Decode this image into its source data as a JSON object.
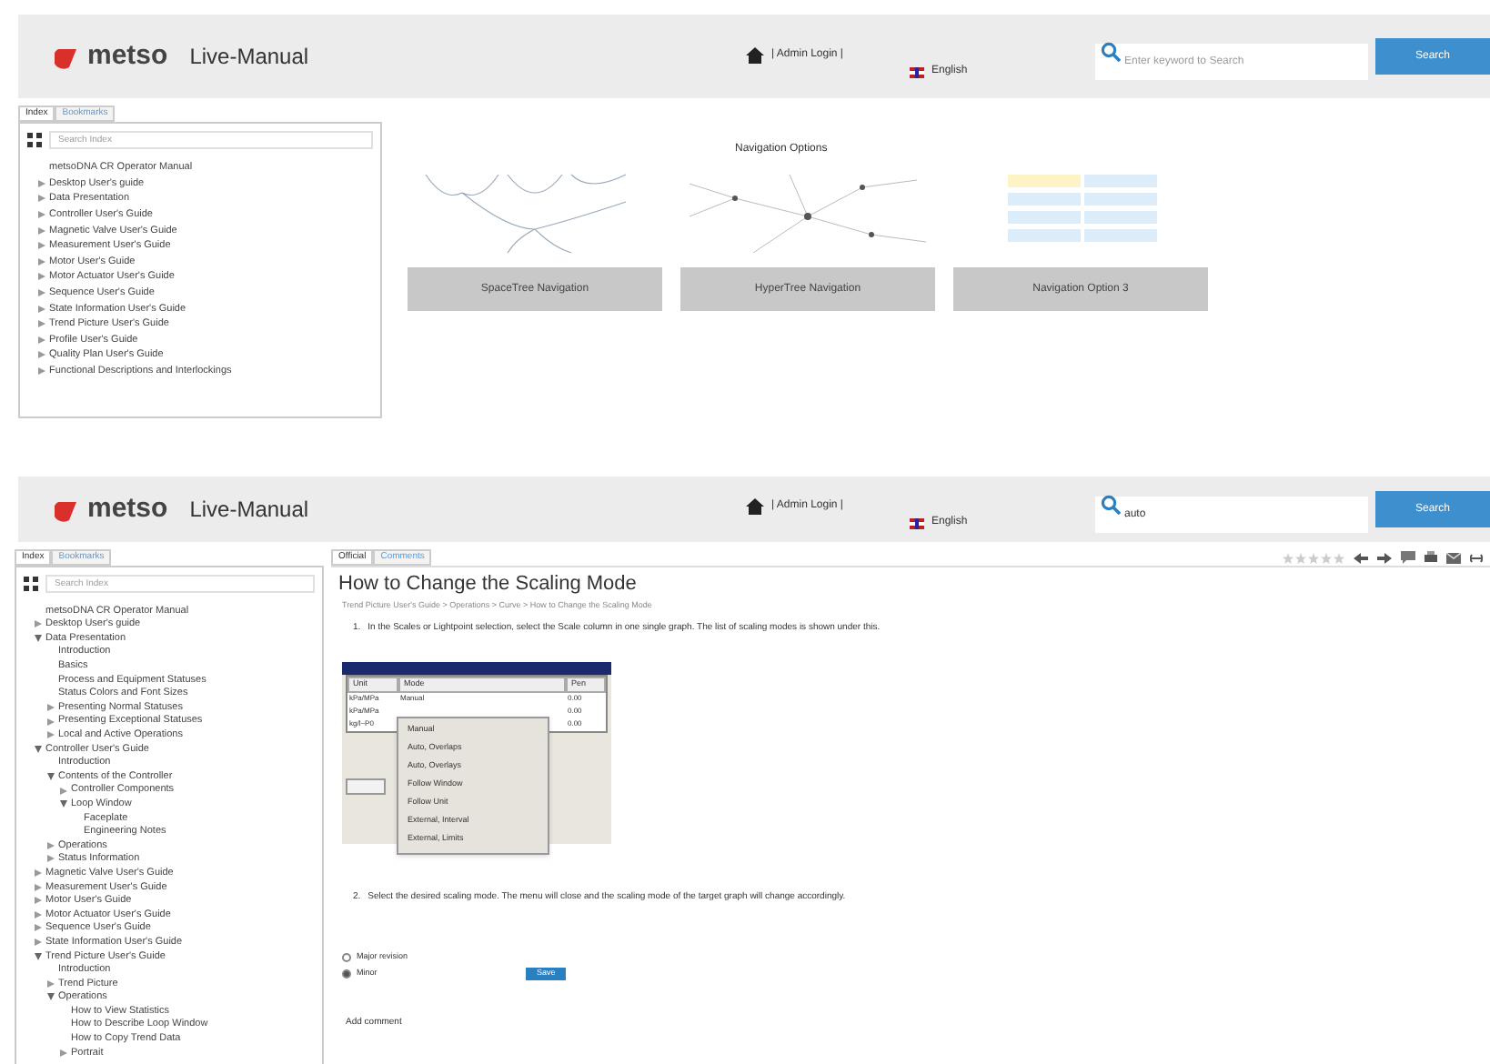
{
  "panels": [
    {
      "header": {
        "logo": "metso",
        "app_name": "Live-Manual",
        "admin_link": "| Admin Login |",
        "language": "English",
        "search": {
          "placeholder": "Enter keyword to Search"
        },
        "search_button": "Search"
      },
      "sidebar": {
        "tabs": [
          {
            "label": "Index",
            "selected": true
          },
          {
            "label": "Bookmarks",
            "selected": false
          }
        ],
        "search_placeholder": "Search Index",
        "tree": [
          {
            "label": "metsoDNA CR Operator Manual",
            "kind": "page"
          },
          {
            "label": "Desktop User's guide",
            "kind": "folder",
            "expanded": false
          },
          {
            "label": "Data Presentation",
            "kind": "folder",
            "expanded": false
          },
          {
            "label": "Controller User's Guide",
            "kind": "folder",
            "expanded": false
          },
          {
            "label": "Magnetic Valve User's Guide",
            "kind": "folder",
            "expanded": false
          },
          {
            "label": "Measurement User's Guide",
            "kind": "folder",
            "expanded": false
          },
          {
            "label": "Motor User's Guide",
            "kind": "folder",
            "expanded": false
          },
          {
            "label": "Motor Actuator User's Guide",
            "kind": "folder",
            "expanded": false
          },
          {
            "label": "Sequence User's Guide",
            "kind": "folder",
            "expanded": false
          },
          {
            "label": "State Information User's Guide",
            "kind": "folder",
            "expanded": false
          },
          {
            "label": "Trend Picture User's Guide",
            "kind": "folder",
            "expanded": false
          },
          {
            "label": "Profile User's Guide",
            "kind": "folder",
            "expanded": false
          },
          {
            "label": "Quality Plan User's Guide",
            "kind": "folder",
            "expanded": false
          },
          {
            "label": "Functional Descriptions and Interlockings",
            "kind": "folder",
            "expanded": false
          }
        ]
      },
      "content": {
        "kind": "navigation",
        "heading": "Navigation Options",
        "options": [
          {
            "label": "SpaceTree Navigation",
            "kind": "spacetree"
          },
          {
            "label": "HyperTree Navigation",
            "kind": "hypertree"
          },
          {
            "label": "Navigation Option 3",
            "kind": "grid"
          }
        ]
      }
    },
    {
      "header": {
        "logo": "metso",
        "app_name": "Live-Manual",
        "admin_link": "| Admin Login |",
        "language": "English",
        "search": {
          "value": "auto"
        },
        "search_button": "Search"
      },
      "sidebar": {
        "tabs": [
          {
            "label": "Index",
            "selected": true
          },
          {
            "label": "Bookmarks",
            "selected": false
          }
        ],
        "search_placeholder": "Search Index",
        "tree": [
          {
            "label": "metsoDNA CR Operator Manual",
            "kind": "page"
          },
          {
            "label": "Desktop User's guide",
            "kind": "folder",
            "expanded": false
          },
          {
            "label": "Data Presentation",
            "kind": "folder",
            "expanded": true,
            "children": [
              {
                "label": "Introduction",
                "kind": "page"
              },
              {
                "label": "Basics",
                "kind": "page"
              },
              {
                "label": "Process and Equipment Statuses",
                "kind": "page"
              },
              {
                "label": "Status Colors and Font Sizes",
                "kind": "page"
              },
              {
                "label": "Presenting Normal Statuses",
                "kind": "folder",
                "expanded": false
              },
              {
                "label": "Presenting Exceptional Statuses",
                "kind": "folder",
                "expanded": false
              },
              {
                "label": "Local and Active Operations",
                "kind": "folder",
                "expanded": false
              }
            ]
          },
          {
            "label": "Controller User's Guide",
            "kind": "folder",
            "expanded": true,
            "children": [
              {
                "label": "Introduction",
                "kind": "page"
              },
              {
                "label": "Contents of the Controller",
                "kind": "folder",
                "expanded": true,
                "children": [
                  {
                    "label": "Controller Components",
                    "kind": "folder",
                    "expanded": false
                  },
                  {
                    "label": "Loop Window",
                    "kind": "folder",
                    "expanded": true,
                    "children": [
                      {
                        "label": "Faceplate",
                        "kind": "page"
                      },
                      {
                        "label": "Engineering Notes",
                        "kind": "page"
                      }
                    ]
                  }
                ]
              },
              {
                "label": "Operations",
                "kind": "folder",
                "expanded": false
              },
              {
                "label": "Status Information",
                "kind": "folder",
                "expanded": false
              }
            ]
          },
          {
            "label": "Magnetic Valve User's Guide",
            "kind": "folder",
            "expanded": false
          },
          {
            "label": "Measurement User's Guide",
            "kind": "folder",
            "expanded": false
          },
          {
            "label": "Motor User's Guide",
            "kind": "folder",
            "expanded": false
          },
          {
            "label": "Motor Actuator User's Guide",
            "kind": "folder",
            "expanded": false
          },
          {
            "label": "Sequence User's Guide",
            "kind": "folder",
            "expanded": false
          },
          {
            "label": "State Information User's Guide",
            "kind": "folder",
            "expanded": false
          },
          {
            "label": "Trend Picture User's Guide",
            "kind": "folder",
            "expanded": true,
            "children": [
              {
                "label": "Introduction",
                "kind": "page"
              },
              {
                "label": "Trend Picture",
                "kind": "folder",
                "expanded": false
              },
              {
                "label": "Operations",
                "kind": "folder",
                "expanded": true,
                "children": [
                  {
                    "label": "How to View Statistics",
                    "kind": "page"
                  },
                  {
                    "label": "How to Describe Loop Window",
                    "kind": "page"
                  },
                  {
                    "label": "How to Copy Trend Data",
                    "kind": "page"
                  },
                  {
                    "label": "Portrait",
                    "kind": "folder",
                    "expanded": false
                  }
                ]
              }
            ]
          }
        ]
      },
      "content": {
        "kind": "article",
        "tabs": [
          {
            "label": "Official",
            "selected": true
          },
          {
            "label": "Comments",
            "selected": false
          }
        ],
        "stars": 0,
        "title": "How to Change the Scaling Mode",
        "breadcrumb": "Trend Picture User's Guide > Operations > Curve > How to Change the Scaling Mode",
        "steps": [
          {
            "number": "1.",
            "text": "In the Scales or Lightpoint selection, select the Scale column in one single graph. The list of scaling modes is shown under this."
          },
          {
            "number": "2.",
            "text": "Select the desired scaling mode. The menu will close and the scaling mode of the target graph will change accordingly."
          }
        ],
        "figure": {
          "columns": [
            "Unit",
            "Mode",
            "Pen"
          ],
          "rows": [
            [
              "kPa/MPa",
              "Manual",
              "0.00"
            ],
            [
              "kPa/MPa",
              "",
              "0.00"
            ],
            [
              "kg/l~P0",
              "",
              "0.00"
            ]
          ],
          "menu": [
            "Manual",
            "Auto, Overlaps",
            "Auto, Overlays",
            "Follow Window",
            "Follow Unit",
            "External, Interval",
            "External, Limits"
          ]
        },
        "revision_options": [
          {
            "label": "Major revision",
            "selected": false
          },
          {
            "label": "Minor",
            "selected": true
          }
        ],
        "save_button": "Save",
        "add_comment": "Add comment"
      }
    }
  ]
}
